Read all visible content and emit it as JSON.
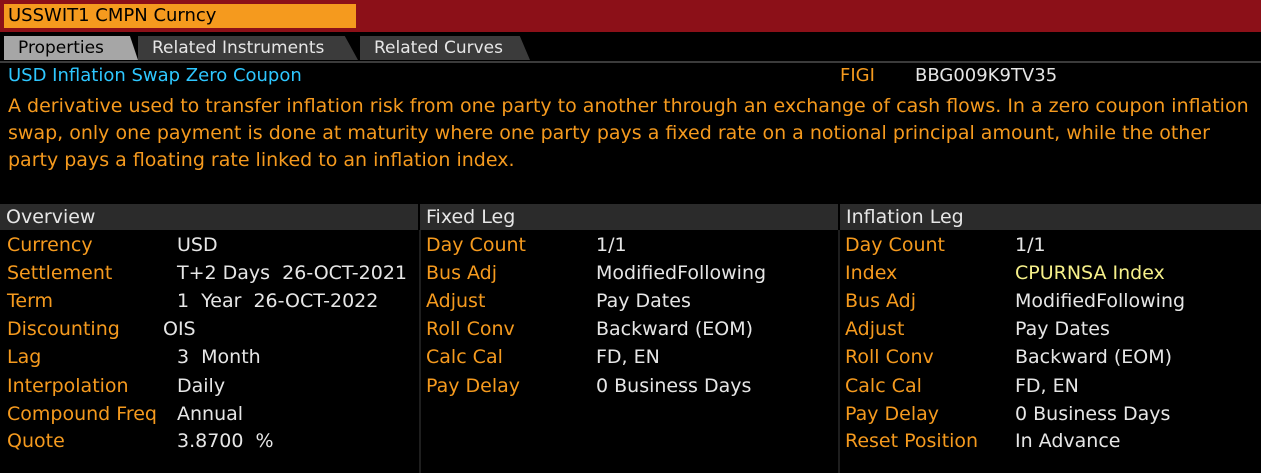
{
  "header": {
    "security": "USSWIT1 CMPN Curncy"
  },
  "tabs": [
    {
      "label": "Properties"
    },
    {
      "label": "Related Instruments"
    },
    {
      "label": "Related Curves"
    }
  ],
  "instrument": {
    "name": "USD Inflation Swap Zero Coupon",
    "figi_label": "FIGI",
    "figi_value": "BBG009K9TV35",
    "description": "A derivative used to transfer inflation risk from one party to another through an exchange of cash flows. In a zero coupon inflation swap, only one payment is done at maturity where one party pays a fixed rate on a notional principal amount, while the other party pays a floating rate linked to an inflation index."
  },
  "overview": {
    "title": "Overview",
    "rows": [
      {
        "label": "Currency",
        "value": "USD"
      },
      {
        "label": "Settlement",
        "value": "T+2 Days  26-OCT-2021"
      },
      {
        "label": "Term",
        "value": "1  Year  26-OCT-2022"
      },
      {
        "label": "Discounting",
        "value": "OIS"
      },
      {
        "label": "Lag",
        "value": "3  Month"
      },
      {
        "label": "Interpolation",
        "value": "Daily"
      },
      {
        "label": "Compound Freq",
        "value": "Annual"
      },
      {
        "label": "Quote",
        "value": "3.8700  %"
      }
    ]
  },
  "fixed_leg": {
    "title": "Fixed Leg",
    "rows": [
      {
        "label": "Day Count",
        "value": "1/1"
      },
      {
        "label": "Bus Adj",
        "value": "ModifiedFollowing"
      },
      {
        "label": "Adjust",
        "value": "Pay Dates"
      },
      {
        "label": "Roll Conv",
        "value": "Backward (EOM)"
      },
      {
        "label": "Calc Cal",
        "value": "FD, EN"
      },
      {
        "label": "Pay Delay",
        "value": "0 Business Days"
      }
    ]
  },
  "inflation_leg": {
    "title": "Inflation Leg",
    "rows": [
      {
        "label": "Day Count",
        "value": "1/1"
      },
      {
        "label": "Index",
        "value": "CPURNSA Index"
      },
      {
        "label": "Bus Adj",
        "value": "ModifiedFollowing"
      },
      {
        "label": "Adjust",
        "value": "Pay Dates"
      },
      {
        "label": "Roll Conv",
        "value": "Backward (EOM)"
      },
      {
        "label": "Calc Cal",
        "value": "FD, EN"
      },
      {
        "label": "Pay Delay",
        "value": "0 Business Days"
      },
      {
        "label": "Reset Position",
        "value": "In Advance"
      }
    ]
  },
  "colors": {
    "accent_orange": "#f59a1e",
    "title_cyan": "#2ec7ff",
    "topbar_red": "#8c1018",
    "link_yellow": "#f6f08a"
  }
}
